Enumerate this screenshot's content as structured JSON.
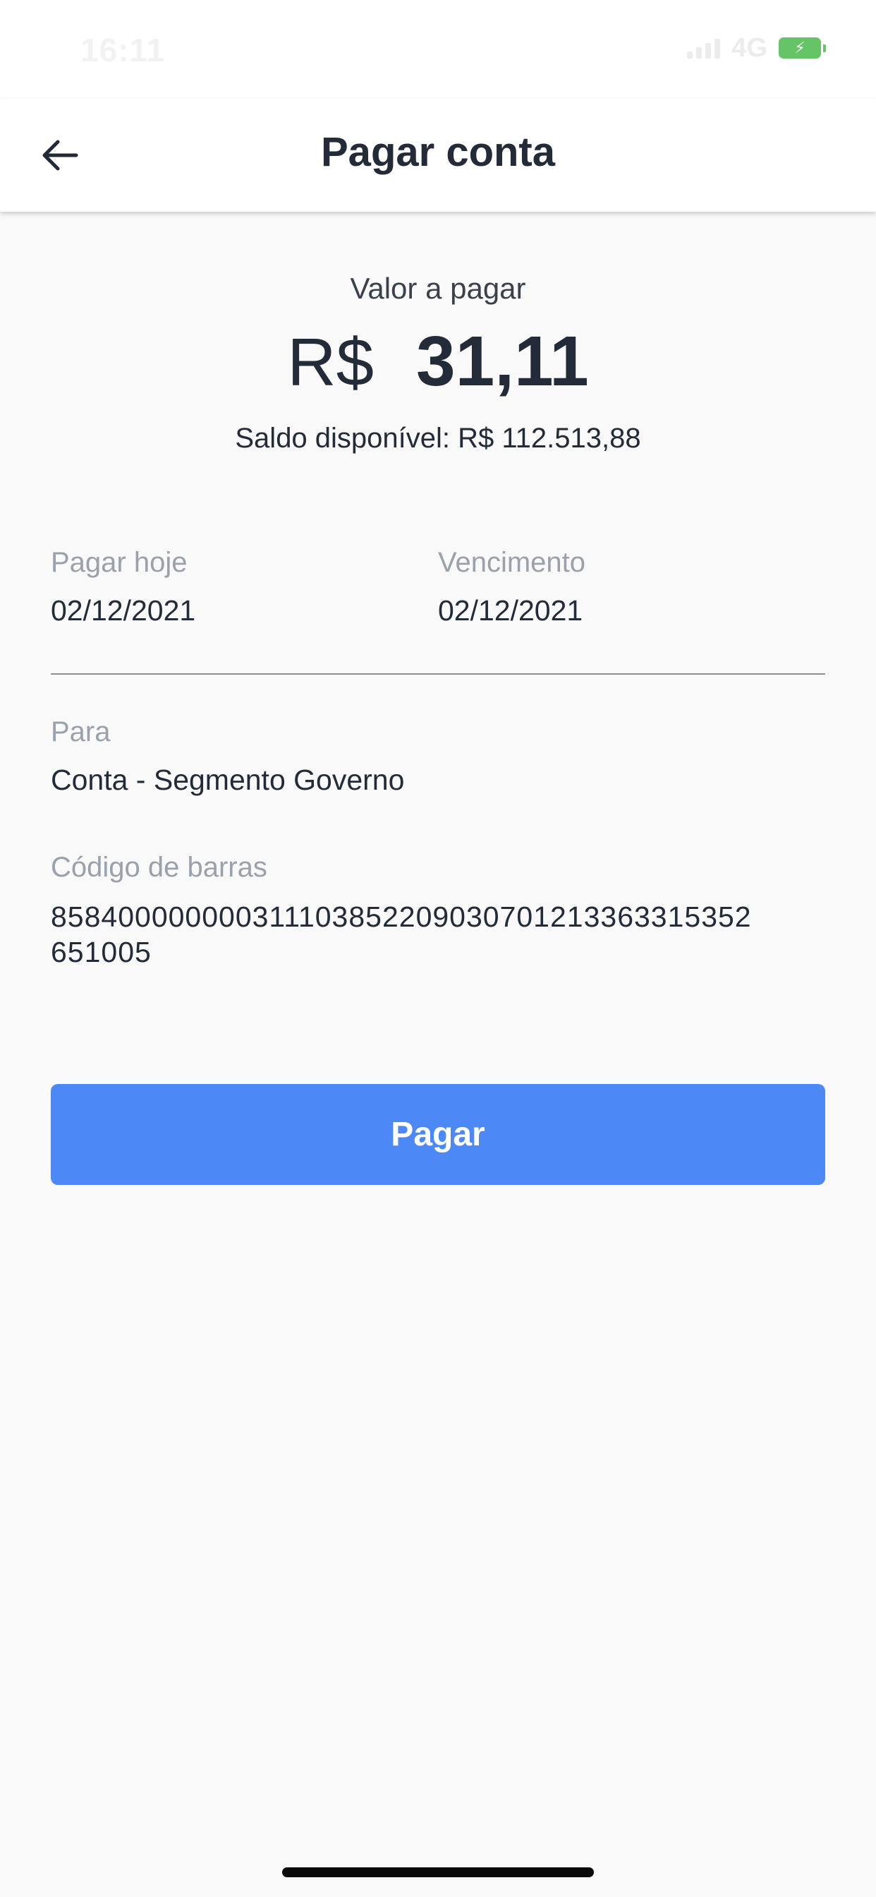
{
  "status_bar": {
    "time": "16:11",
    "network": "4G",
    "battery_color": "#65c466"
  },
  "header": {
    "title": "Pagar conta",
    "back_icon": "arrow-left-icon"
  },
  "payment": {
    "amount_label": "Valor a pagar",
    "currency": "R$",
    "amount": "31,11",
    "balance_text": "Saldo disponível: R$ 112.513,88"
  },
  "dates": {
    "pay_today_label": "Pagar hoje",
    "pay_today_value": "02/12/2021",
    "due_label": "Vencimento",
    "due_value": "02/12/2021"
  },
  "recipient": {
    "label": "Para",
    "value": "Conta - Segmento Governo"
  },
  "barcode": {
    "label": "Código de barras",
    "line1": "858400000000311103852209030701213363315352",
    "line2": "651005"
  },
  "actions": {
    "pay_label": "Pagar",
    "accent_color": "#4c89f6"
  }
}
